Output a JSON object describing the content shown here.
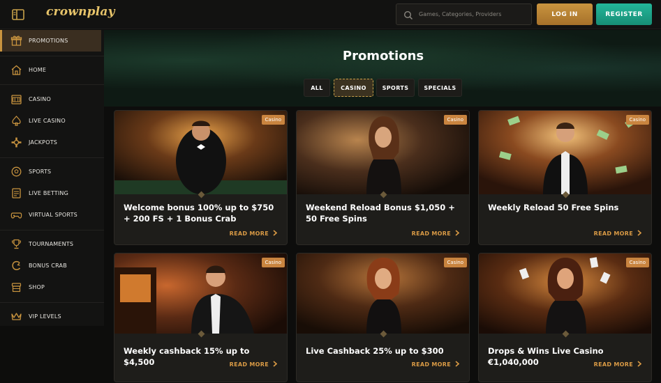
{
  "header": {
    "logo": "crownplay",
    "search_placeholder": "Games, Categories, Providers",
    "login": "LOG IN",
    "register": "REGISTER"
  },
  "sidebar": {
    "items": [
      {
        "label": "PROMOTIONS",
        "icon": "gift-icon",
        "active": true
      },
      {
        "label": "HOME",
        "icon": "home-icon"
      },
      {
        "label": "CASINO",
        "icon": "slot-machine-icon"
      },
      {
        "label": "LIVE CASINO",
        "icon": "spade-icon"
      },
      {
        "label": "JACKPOTS",
        "icon": "jackpot-icon"
      },
      {
        "label": "SPORTS",
        "icon": "ball-icon"
      },
      {
        "label": "LIVE BETTING",
        "icon": "live-betting-icon"
      },
      {
        "label": "VIRTUAL SPORTS",
        "icon": "gamepad-icon"
      },
      {
        "label": "TOURNAMENTS",
        "icon": "trophy-icon"
      },
      {
        "label": "BONUS CRAB",
        "icon": "crab-icon"
      },
      {
        "label": "SHOP",
        "icon": "shop-icon"
      },
      {
        "label": "VIP LEVELS",
        "icon": "crown-icon"
      }
    ]
  },
  "main": {
    "title": "Promotions",
    "filters": [
      "ALL",
      "CASINO",
      "SPORTS",
      "SPECIALS"
    ],
    "active_filter": "CASINO",
    "cards": [
      {
        "badge": "Casino",
        "title": "Welcome bonus 100% up to $750 + 200 FS + 1 Bonus Crab",
        "cta": "READ MORE"
      },
      {
        "badge": "Casino",
        "title": "Weekend Reload Bonus $1,050 + 50 Free Spins",
        "cta": "READ MORE"
      },
      {
        "badge": "Casino",
        "title": "Weekly Reload 50 Free Spins",
        "cta": "READ MORE"
      },
      {
        "badge": "Casino",
        "title": "Weekly cashback 15% up to $4,500",
        "cta": "READ MORE"
      },
      {
        "badge": "Casino",
        "title": "Live Cashback 25% up to $300",
        "cta": "READ MORE"
      },
      {
        "badge": "Casino",
        "title": "Drops & Wins Live Casino €1,040,000",
        "cta": "READ MORE"
      }
    ]
  },
  "colors": {
    "accent_gold": "#c9943f",
    "register_green": "#1fa88a",
    "badge": "#c9843f"
  }
}
